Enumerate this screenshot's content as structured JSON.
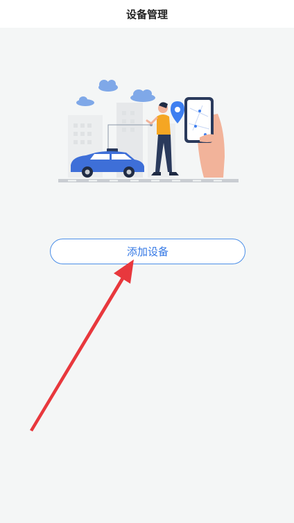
{
  "header": {
    "title": "设备管理"
  },
  "main": {
    "add_device_label": "添加设备"
  },
  "colors": {
    "accent": "#3478e5",
    "annotation": "#e8383d",
    "background": "#f4f6f6"
  }
}
